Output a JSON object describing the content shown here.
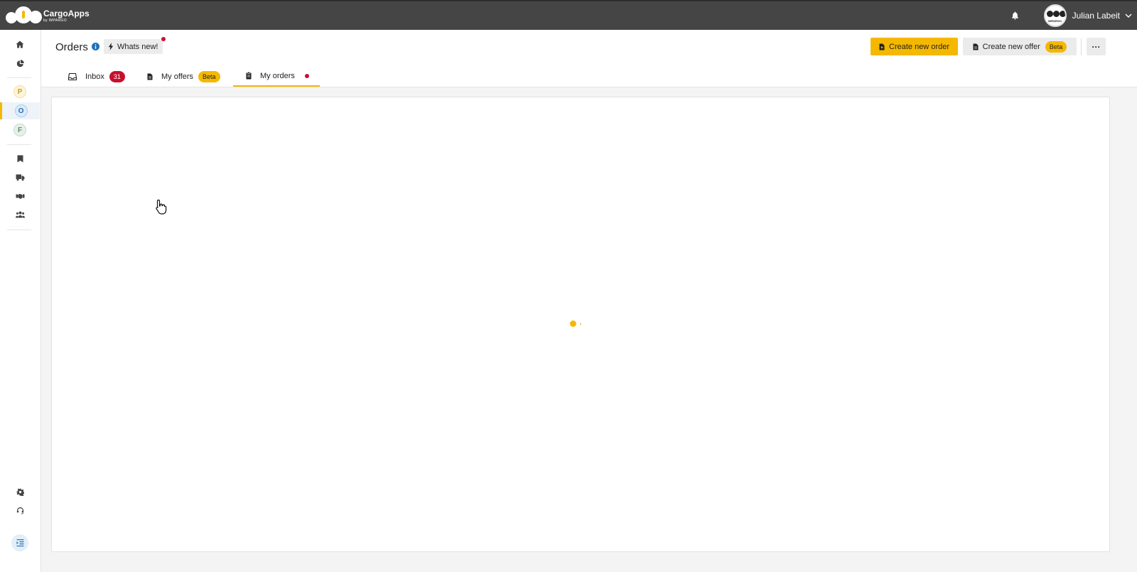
{
  "app": {
    "name": "CargoApps",
    "byline": "by IMPARGO"
  },
  "user": {
    "name": "Julian Labeit",
    "avatar_brand": "IMPARGO"
  },
  "sidebar": {
    "letters": [
      "P",
      "O",
      "F"
    ],
    "active_letter": "O",
    "icons": [
      "home-icon",
      "chart-pie-icon",
      "bookmark-icon",
      "truck-icon",
      "handshake-icon",
      "users-icon",
      "gear-icon",
      "headset-icon",
      "collapse-sidebar-icon"
    ]
  },
  "header": {
    "title": "Orders",
    "whats_new": "Whats new!",
    "create_order": "Create new order",
    "create_offer": "Create new offer",
    "create_offer_badge": "Beta",
    "more": "···"
  },
  "tabs": [
    {
      "label": "Inbox",
      "badge": "31"
    },
    {
      "label": "My offers",
      "badge": "Beta"
    },
    {
      "label": "My orders",
      "active": true
    }
  ],
  "colors": {
    "accent": "#f5b800",
    "topbar": "#454545",
    "alert": "#c8102e",
    "active_letter": "#1f6fb8"
  }
}
